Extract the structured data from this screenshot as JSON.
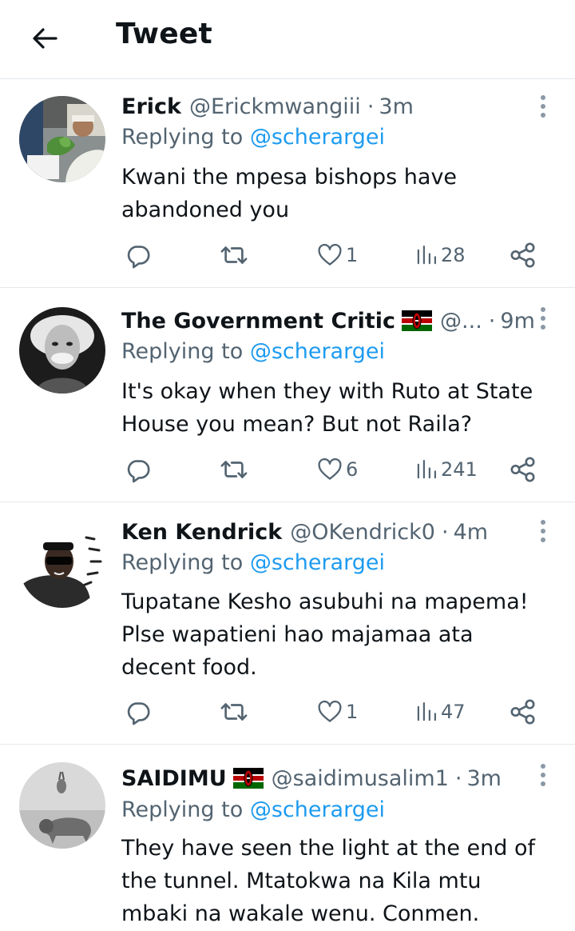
{
  "header": {
    "title": "Tweet",
    "back_icon": "arrow-left-icon"
  },
  "tweets": [
    {
      "name": "Erick",
      "handle": "@Erickmwangiii",
      "separator": "·",
      "time": "3m",
      "replying_prefix": "Replying to",
      "replying_to": "@scherargei",
      "text": "Kwani the mpesa bishops have abandoned you",
      "likes": "1",
      "views": "28"
    },
    {
      "name": "The Government Critic",
      "handle": "@...",
      "separator": "·",
      "time": "9m",
      "replying_prefix": "Replying to",
      "replying_to": "@scherargei",
      "text": "It's okay when they with Ruto at State House you mean? But not Raila?",
      "likes": "6",
      "views": "241"
    },
    {
      "name": "Ken Kendrick",
      "handle": "@OKendrick0",
      "separator": "·",
      "time": "4m",
      "replying_prefix": "Replying to",
      "replying_to": "@scherargei",
      "text": "Tupatane Kesho asubuhi na mapema! Plse wapatieni hao majamaa ata decent food.",
      "likes": "1",
      "views": "47"
    },
    {
      "name": "SAIDIMU",
      "handle": "@saidimusalim1",
      "separator": "·",
      "time": "3m",
      "replying_prefix": "Replying to",
      "replying_to": "@scherargei",
      "text": "They have seen the light at the end of the tunnel. Mtatokwa na Kila mtu mbaki na wakale wenu.  Conmen."
    }
  ],
  "icons": {
    "reply": "reply-bubble-icon",
    "retweet": "retweet-icon",
    "like": "heart-icon",
    "views": "views-bar-icon",
    "share": "share-icon",
    "more": "more-vertical-icon",
    "flag": "kenya-flag-icon"
  },
  "colors": {
    "link": "#1d9bf0",
    "secondary_text": "#536471",
    "primary_text": "#0f1419",
    "divider": "#e4e8eb"
  }
}
